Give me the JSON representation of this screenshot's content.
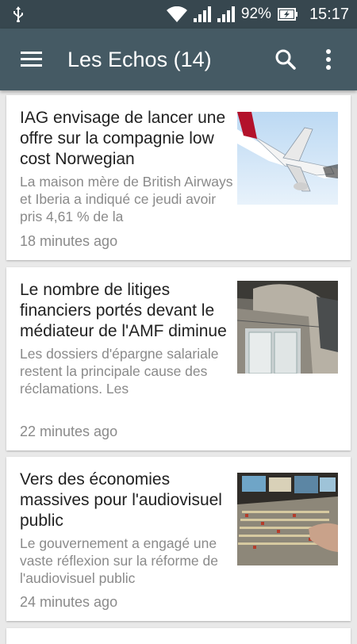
{
  "status_bar": {
    "battery": "92%",
    "time": "15:17",
    "icons": [
      "usb-icon",
      "wifi-icon",
      "signal-icon",
      "signal-icon",
      "battery-charging-icon"
    ]
  },
  "app_bar": {
    "title": "Les Echos (14)",
    "icons": [
      "menu-icon",
      "search-icon",
      "more-vert-icon"
    ]
  },
  "articles": [
    {
      "headline": "IAG envisage de lancer une offre sur la compagnie low cost Norwegian",
      "summary": "La maison mère de British Airways et Iberia a indiqué ce jeudi avoir pris 4,61 % de la",
      "time": "18 minutes ago",
      "image": "airplane-photo"
    },
    {
      "headline": "Le nombre de litiges financiers portés devant le médiateur de l'AMF diminue",
      "summary": "Les dossiers d'épargne salariale restent la principale cause des réclamations. Les",
      "time": "22 minutes ago",
      "image": "building-entrance-photo"
    },
    {
      "headline": "Vers des économies massives pour l'audiovisuel public",
      "summary": "Le gouvernement a engagé une vaste réflexion sur la réforme de l'audiovisuel public",
      "time": "24 minutes ago",
      "image": "mixing-console-photo"
    }
  ],
  "colors": {
    "status_bar": "#37474f",
    "app_bar": "#455a64",
    "background": "#e9e9e9",
    "headline": "#212121",
    "secondary_text": "#8a8a8a"
  }
}
